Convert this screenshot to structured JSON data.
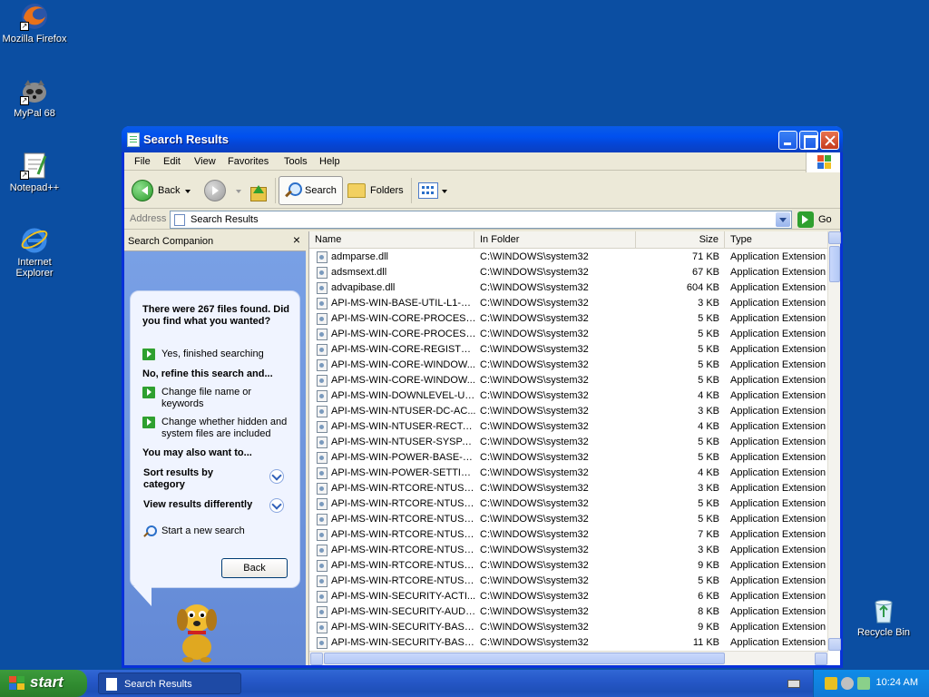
{
  "desktop": {
    "icons": [
      {
        "label": "Mozilla Firefox"
      },
      {
        "label": "MyPal 68"
      },
      {
        "label": "Notepad++"
      },
      {
        "label": "Internet Explorer"
      },
      {
        "label": "Recycle Bin"
      }
    ]
  },
  "window": {
    "title": "Search Results",
    "menu": [
      "File",
      "Edit",
      "View",
      "Favorites",
      "Tools",
      "Help"
    ],
    "toolbar": {
      "back": "Back",
      "search": "Search",
      "folders": "Folders"
    },
    "address": {
      "label": "Address",
      "value": "Search Results",
      "go": "Go"
    }
  },
  "companion": {
    "header": "Search Companion",
    "close": "×",
    "found_text": "There were 267 files found. Did you find what you wanted?",
    "yes_link": "Yes, finished searching",
    "refine_heading": "No, refine this search and...",
    "change_name": "Change file name or keywords",
    "change_hidden": "Change whether hidden and system files are included",
    "also_heading": "You may also want to...",
    "sort_results": "Sort results by category",
    "view_results": "View results differently",
    "new_search": "Start a new search",
    "back_button": "Back"
  },
  "filelist": {
    "columns": {
      "name": "Name",
      "folder": "In Folder",
      "size": "Size",
      "type": "Type"
    },
    "rows": [
      {
        "name": "admparse.dll",
        "folder": "C:\\WINDOWS\\system32",
        "size": "71 KB",
        "type": "Application Extension"
      },
      {
        "name": "adsmsext.dll",
        "folder": "C:\\WINDOWS\\system32",
        "size": "67 KB",
        "type": "Application Extension"
      },
      {
        "name": "advapibase.dll",
        "folder": "C:\\WINDOWS\\system32",
        "size": "604 KB",
        "type": "Application Extension"
      },
      {
        "name": "API-MS-WIN-BASE-UTIL-L1-1-...",
        "folder": "C:\\WINDOWS\\system32",
        "size": "3 KB",
        "type": "Application Extension"
      },
      {
        "name": "API-MS-WIN-CORE-PROCESS...",
        "folder": "C:\\WINDOWS\\system32",
        "size": "5 KB",
        "type": "Application Extension"
      },
      {
        "name": "API-MS-WIN-CORE-PROCESS...",
        "folder": "C:\\WINDOWS\\system32",
        "size": "5 KB",
        "type": "Application Extension"
      },
      {
        "name": "API-MS-WIN-CORE-REGISTR...",
        "folder": "C:\\WINDOWS\\system32",
        "size": "5 KB",
        "type": "Application Extension"
      },
      {
        "name": "API-MS-WIN-CORE-WINDOW...",
        "folder": "C:\\WINDOWS\\system32",
        "size": "5 KB",
        "type": "Application Extension"
      },
      {
        "name": "API-MS-WIN-CORE-WINDOW...",
        "folder": "C:\\WINDOWS\\system32",
        "size": "5 KB",
        "type": "Application Extension"
      },
      {
        "name": "API-MS-WIN-DOWNLEVEL-US...",
        "folder": "C:\\WINDOWS\\system32",
        "size": "4 KB",
        "type": "Application Extension"
      },
      {
        "name": "API-MS-WIN-NTUSER-DC-AC...",
        "folder": "C:\\WINDOWS\\system32",
        "size": "3 KB",
        "type": "Application Extension"
      },
      {
        "name": "API-MS-WIN-NTUSER-RECTA...",
        "folder": "C:\\WINDOWS\\system32",
        "size": "4 KB",
        "type": "Application Extension"
      },
      {
        "name": "API-MS-WIN-NTUSER-SYSPA...",
        "folder": "C:\\WINDOWS\\system32",
        "size": "5 KB",
        "type": "Application Extension"
      },
      {
        "name": "API-MS-WIN-POWER-BASE-L...",
        "folder": "C:\\WINDOWS\\system32",
        "size": "5 KB",
        "type": "Application Extension"
      },
      {
        "name": "API-MS-WIN-POWER-SETTIN...",
        "folder": "C:\\WINDOWS\\system32",
        "size": "4 KB",
        "type": "Application Extension"
      },
      {
        "name": "API-MS-WIN-RTCORE-NTUSE...",
        "folder": "C:\\WINDOWS\\system32",
        "size": "3 KB",
        "type": "Application Extension"
      },
      {
        "name": "API-MS-WIN-RTCORE-NTUSE...",
        "folder": "C:\\WINDOWS\\system32",
        "size": "5 KB",
        "type": "Application Extension"
      },
      {
        "name": "API-MS-WIN-RTCORE-NTUSE...",
        "folder": "C:\\WINDOWS\\system32",
        "size": "5 KB",
        "type": "Application Extension"
      },
      {
        "name": "API-MS-WIN-RTCORE-NTUSE...",
        "folder": "C:\\WINDOWS\\system32",
        "size": "7 KB",
        "type": "Application Extension"
      },
      {
        "name": "API-MS-WIN-RTCORE-NTUSE...",
        "folder": "C:\\WINDOWS\\system32",
        "size": "3 KB",
        "type": "Application Extension"
      },
      {
        "name": "API-MS-WIN-RTCORE-NTUSE...",
        "folder": "C:\\WINDOWS\\system32",
        "size": "9 KB",
        "type": "Application Extension"
      },
      {
        "name": "API-MS-WIN-RTCORE-NTUSE...",
        "folder": "C:\\WINDOWS\\system32",
        "size": "5 KB",
        "type": "Application Extension"
      },
      {
        "name": "API-MS-WIN-SECURITY-ACTI...",
        "folder": "C:\\WINDOWS\\system32",
        "size": "6 KB",
        "type": "Application Extension"
      },
      {
        "name": "API-MS-WIN-SECURITY-AUDI...",
        "folder": "C:\\WINDOWS\\system32",
        "size": "8 KB",
        "type": "Application Extension"
      },
      {
        "name": "API-MS-WIN-SECURITY-BASE...",
        "folder": "C:\\WINDOWS\\system32",
        "size": "9 KB",
        "type": "Application Extension"
      },
      {
        "name": "API-MS-WIN-SECURITY-BASE...",
        "folder": "C:\\WINDOWS\\system32",
        "size": "11 KB",
        "type": "Application Extension"
      }
    ]
  },
  "taskbar": {
    "start": "start",
    "task": "Search Results",
    "clock": "10:24 AM"
  },
  "colors": {
    "desktop": "#0b4ea2",
    "titlebar": "#0050ee",
    "start": "#2f8a2f"
  }
}
